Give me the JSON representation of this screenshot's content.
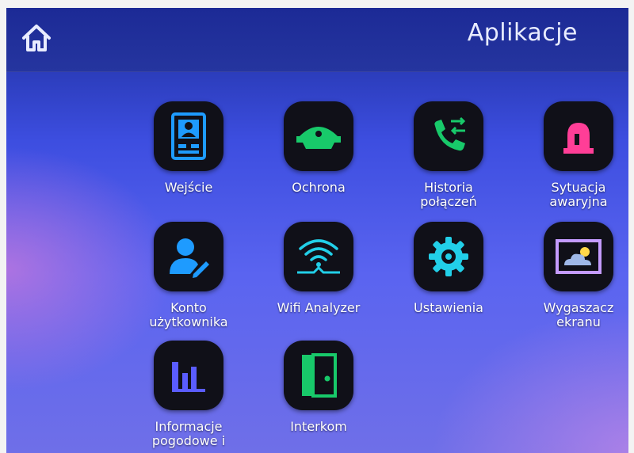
{
  "header": {
    "title": "Aplikacje"
  },
  "apps": [
    {
      "label": "Wejście",
      "icon": "entrance-panel-icon",
      "color": "#1e9bff"
    },
    {
      "label": "Ochrona",
      "icon": "police-cap-icon",
      "color": "#18c96a"
    },
    {
      "label": "Historia\npołączeń",
      "icon": "call-history-icon",
      "color": "#18c96a"
    },
    {
      "label": "Sytuacja\nawaryjna",
      "icon": "alarm-siren-icon",
      "color": "#ff3e97"
    },
    {
      "label": "Konto\nużytkownika",
      "icon": "user-account-icon",
      "color": "#1e9bff"
    },
    {
      "label": "Wifi Analyzer",
      "icon": "wifi-icon",
      "color": "#22cfe8"
    },
    {
      "label": "Ustawienia",
      "icon": "gear-icon",
      "color": "#22cfe8"
    },
    {
      "label": "Wygaszacz\nekranu",
      "icon": "screensaver-icon",
      "color": "#c49bff"
    },
    {
      "label": "Informacje\npogodowe i",
      "icon": "bar-chart-icon",
      "color": "#5a5cff"
    },
    {
      "label": "Interkom",
      "icon": "intercom-door-icon",
      "color": "#18c96a"
    }
  ]
}
